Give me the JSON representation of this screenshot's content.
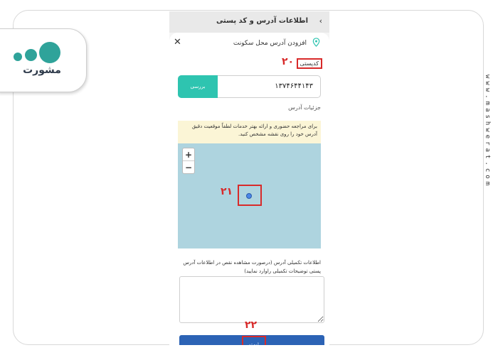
{
  "watermark": {
    "url": "www.mashwerat.com",
    "logo_text": "مشورت"
  },
  "screen": {
    "top_title": "اطلاعات آدرس و کد پستی",
    "sheet_title": "افزودن آدرس محل سکونت",
    "postal_code_label": "کدپستی",
    "postal_code_value": "۱۳۷۴۶۴۴۱۴۳",
    "check_button": "بررسی",
    "address_details_label": "جزئیات آدرس",
    "notice": "برای مراجعه حضوری و ارائه بهتر خدمات لطفاً موقعیت دقیق آدرس خود را روی نقشه مشخص کنید.",
    "zoom_in": "+",
    "zoom_out": "−",
    "extra_info_label": "اطلاعات تکمیلی آدرس (درصورت مشاهده نقص در اطلاعات آدرس پستی توضیحات تکمیلی راوارد نمایید)",
    "extra_info_value": "",
    "submit_label": "ثبت"
  },
  "step_markers": {
    "postal": "۲۰",
    "map": "۲۱",
    "submit": "۲۲"
  },
  "colors": {
    "accent_teal": "#2ec4b0",
    "primary_blue": "#2c63b5",
    "highlight_red": "#d82a2a",
    "map_water": "#aed4df",
    "notice_bg": "#fbf5d6"
  }
}
